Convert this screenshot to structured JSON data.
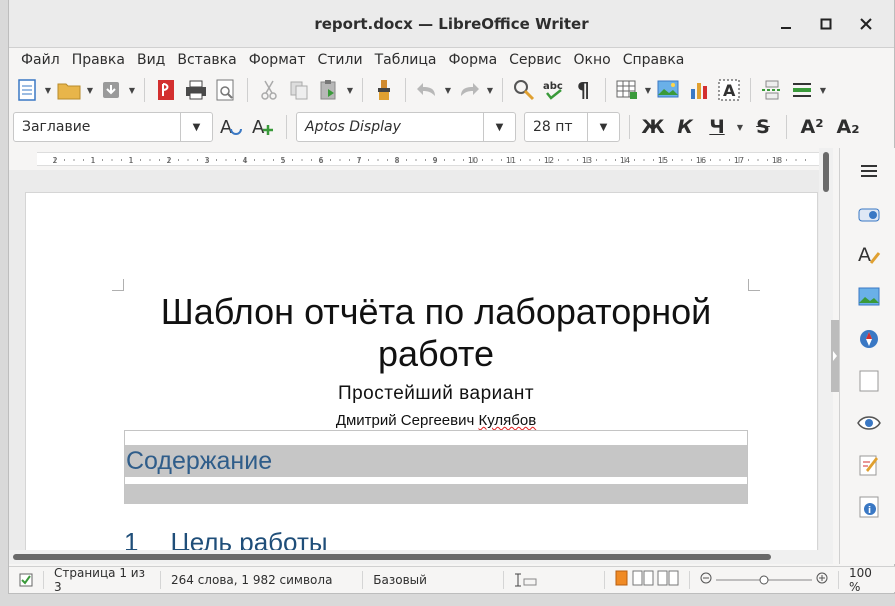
{
  "window": {
    "title": "report.docx — LibreOffice Writer"
  },
  "menu": [
    "Файл",
    "Правка",
    "Вид",
    "Вставка",
    "Формат",
    "Стили",
    "Таблица",
    "Форма",
    "Сервис",
    "Окно",
    "Справка"
  ],
  "format_toolbar": {
    "paragraph_style": "Заглавие",
    "font_name": "Aptos Display",
    "font_size": "28 пт",
    "bold": "Ж",
    "italic": "К",
    "underline": "Ч",
    "strike": "S",
    "superscript": "A²",
    "subscript": "A₂"
  },
  "ruler": {
    "labels": [
      "2",
      "1",
      "1",
      "2",
      "3",
      "4",
      "5",
      "6",
      "7",
      "8",
      "9",
      "10",
      "11",
      "12",
      "13",
      "14",
      "15",
      "16",
      "17",
      "18"
    ]
  },
  "document": {
    "title": "Шаблон отчёта по лабораторной работе",
    "subtitle": "Простейший вариант",
    "author_first": "Дмитрий Сергеевич ",
    "author_last": "Кулябов",
    "toc_heading": "Содержание",
    "heading1_number": "1",
    "heading1_text": "Цель работы"
  },
  "statusbar": {
    "page": "Страница 1 из 3",
    "words": "264 слова, 1 982 символа",
    "page_style": "Базовый",
    "zoom": "100 %"
  },
  "colors": {
    "heading_blue": "#1f4e79",
    "toc_blue": "#2f5d8a",
    "field_shading": "#c6c6c6"
  }
}
